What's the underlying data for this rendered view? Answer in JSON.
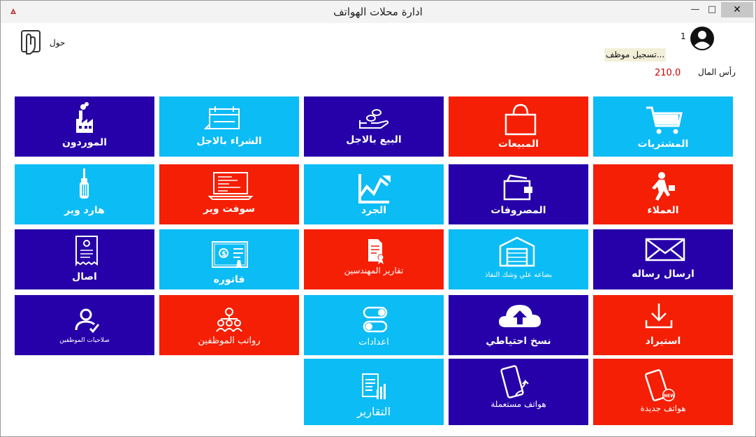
{
  "window": {
    "title": "ادارة محلات الهواتف"
  },
  "header": {
    "about_label": "حول",
    "user_count": "1",
    "login_button": "تسجيل موظف...",
    "capital_label": "رأس المال",
    "capital_value": "210.0"
  },
  "tiles": [
    {
      "label": "المشتريات",
      "icon": "cart-icon",
      "color": "#0cbcf5"
    },
    {
      "label": "المبيعات",
      "icon": "shopping-bag-icon",
      "color": "#f41f05"
    },
    {
      "label": "البيع بالاجل",
      "icon": "hand-coins-icon",
      "color": "#2600a8"
    },
    {
      "label": "الشراء بالاجل",
      "icon": "calendar-icon",
      "color": "#0cbcf5"
    },
    {
      "label": "الموردون",
      "icon": "factory-icon",
      "color": "#2600a8"
    },
    {
      "label": "العملاء",
      "icon": "walking-person-icon",
      "color": "#f41f05"
    },
    {
      "label": "المصروفات",
      "icon": "wallet-icon",
      "color": "#2600a8"
    },
    {
      "label": "الجرد",
      "icon": "inventory-chart-icon",
      "color": "#0cbcf5"
    },
    {
      "label": "سوفت وير",
      "icon": "laptop-code-icon",
      "color": "#f41f05"
    },
    {
      "label": "هارد وير",
      "icon": "screwdriver-icon",
      "color": "#0cbcf5"
    },
    {
      "label": "ارسال رساله",
      "icon": "envelope-icon",
      "color": "#2600a8"
    },
    {
      "label": "بضاعه علي وشك النفاذ",
      "icon": "warehouse-icon",
      "color": "#0cbcf5"
    },
    {
      "label": "تقارير المهندسين",
      "icon": "report-document-icon",
      "color": "#f41f05"
    },
    {
      "label": "فاتوره",
      "icon": "invoice-icon",
      "color": "#0cbcf5"
    },
    {
      "label": "اصال",
      "icon": "receipt-icon",
      "color": "#2600a8"
    },
    {
      "label": "استيراد",
      "icon": "download-icon",
      "color": "#f41f05"
    },
    {
      "label": "نسخ احتياطي",
      "icon": "cloud-upload-icon",
      "color": "#2600a8"
    },
    {
      "label": "اعدادات",
      "icon": "toggle-settings-icon",
      "color": "#0cbcf5"
    },
    {
      "label": "رواتب الموظفين",
      "icon": "salary-people-icon",
      "color": "#f41f05"
    },
    {
      "label": "صلاحيات الموظفين",
      "icon": "user-check-icon",
      "color": "#2600a8"
    },
    {
      "label": "هواتف جديدة",
      "icon": "new-phone-icon",
      "color": "#f41f05"
    },
    {
      "label": "هواتف مستعملة",
      "icon": "used-phone-icon",
      "color": "#2600a8"
    },
    {
      "label": "التقارير",
      "icon": "reports-chart-icon",
      "color": "#0cbcf5"
    }
  ]
}
